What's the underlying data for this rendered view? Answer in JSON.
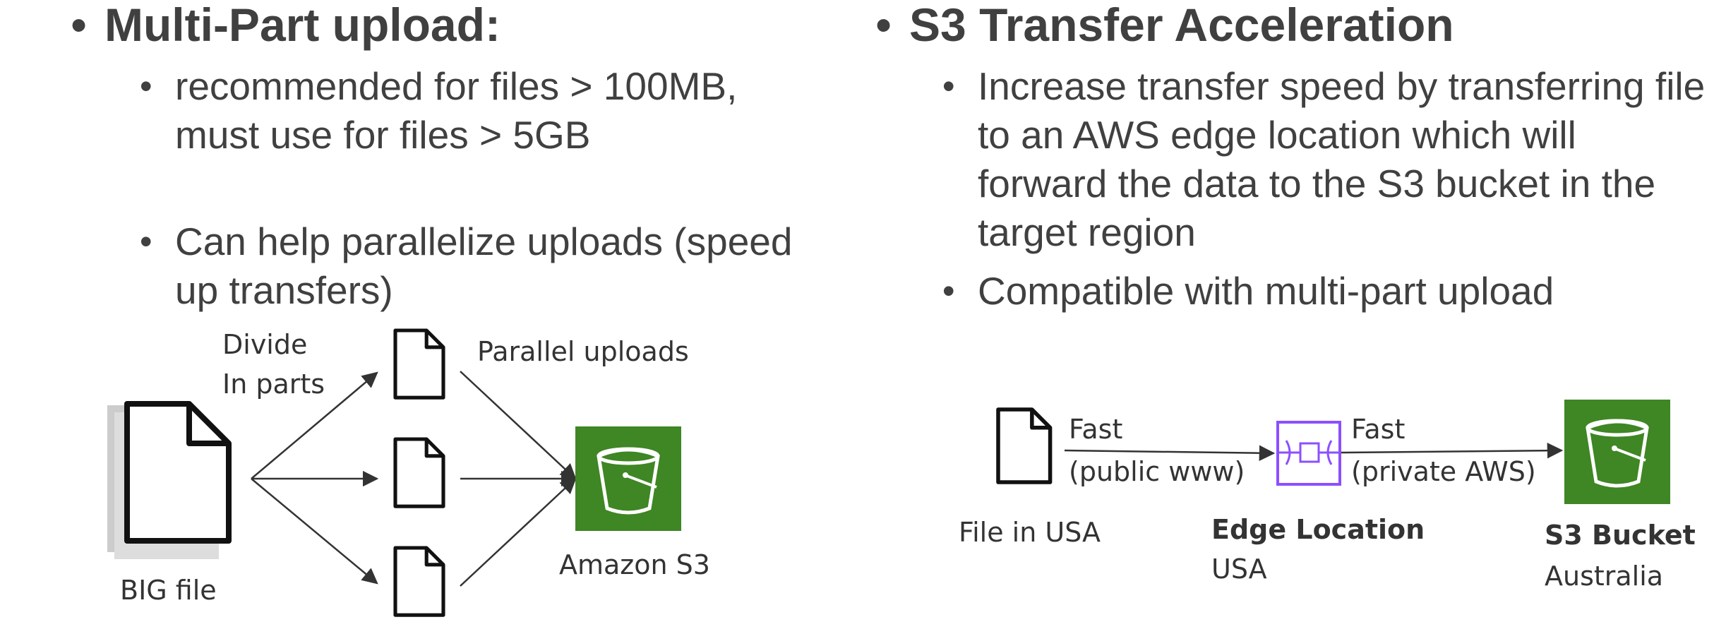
{
  "left": {
    "heading": "Multi-Part upload:",
    "bullets": [
      "recommended for files > 100MB, must use for files > 5GB",
      "Can help parallelize uploads (speed up transfers)"
    ],
    "diagram": {
      "divide_label_1": "Divide",
      "divide_label_2": "In parts",
      "parallel_label": "Parallel uploads",
      "big_file_label": "BIG file",
      "s3_label": "Amazon S3"
    }
  },
  "right": {
    "heading": "S3 Transfer Acceleration",
    "bullets": [
      "Increase transfer speed by transferring file to an AWS edge location which will forward the data to the S3 bucket in the target region",
      "Compatible with multi-part upload"
    ],
    "diagram": {
      "fast_1": "Fast",
      "public_www": "(public www)",
      "fast_2": "Fast",
      "private_aws": "(private AWS)",
      "file_label": "File in USA",
      "edge_title": "Edge Location",
      "edge_sub": "USA",
      "bucket_title": "S3 Bucket",
      "bucket_sub": "Australia"
    }
  },
  "colors": {
    "text": "#404040",
    "s3_green": "#3f8624",
    "edge_purple": "#8c4fff"
  },
  "icons": [
    "document-icon",
    "s3-bucket-icon",
    "edge-location-icon"
  ]
}
